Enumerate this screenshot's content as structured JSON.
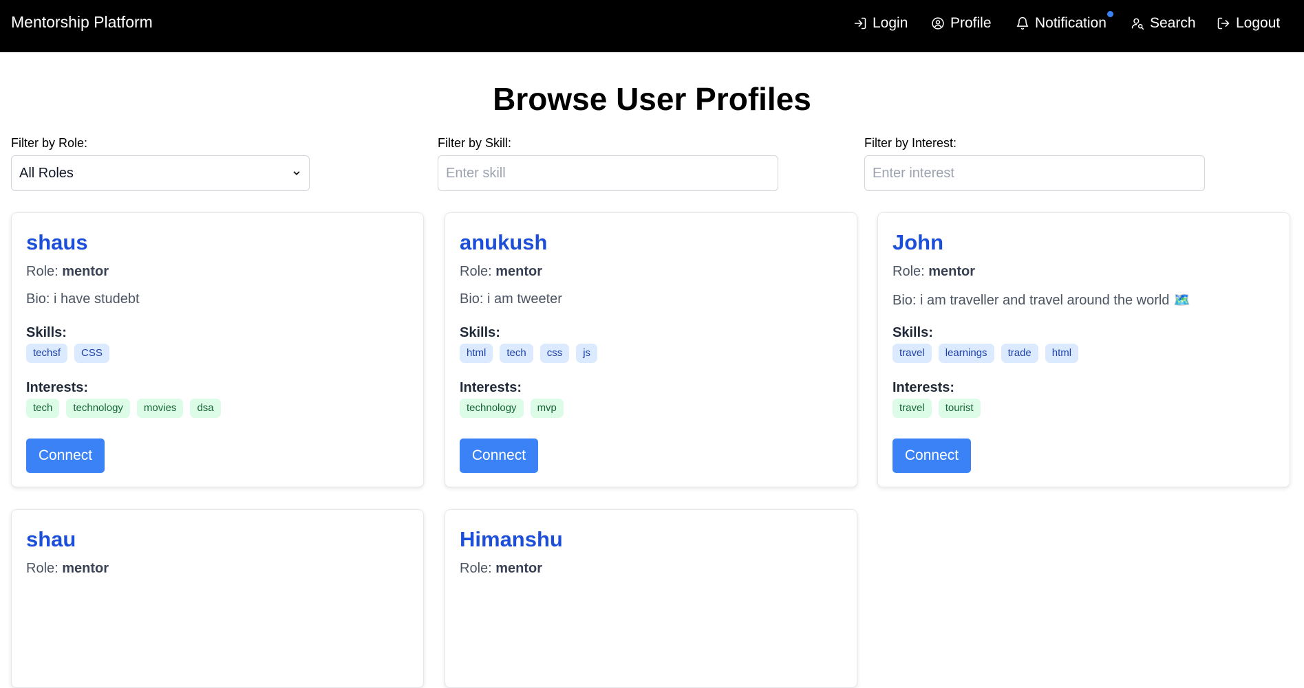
{
  "navbar": {
    "brand": "Mentorship Platform",
    "links": [
      {
        "label": "Login",
        "icon": "login-icon"
      },
      {
        "label": "Profile",
        "icon": "user-circle-icon"
      },
      {
        "label": "Notification",
        "icon": "bell-icon"
      },
      {
        "label": "Search",
        "icon": "user-search-icon"
      },
      {
        "label": "Logout",
        "icon": "logout-icon"
      }
    ],
    "notification_dot_color": "#3b82f6"
  },
  "page": {
    "title": "Browse User Profiles"
  },
  "filters": {
    "role": {
      "label": "Filter by Role:",
      "selected": "All Roles"
    },
    "skill": {
      "label": "Filter by Skill:",
      "placeholder": "Enter skill"
    },
    "interest": {
      "label": "Filter by Interest:",
      "placeholder": "Enter interest"
    }
  },
  "labels": {
    "role_prefix": "Role:",
    "bio_prefix": "Bio:",
    "skills": "Skills:",
    "interests": "Interests:",
    "connect": "Connect"
  },
  "profiles": [
    {
      "name": "shaus",
      "role": "mentor",
      "bio": "i have studebt",
      "skills": [
        "techsf",
        "CSS"
      ],
      "interests": [
        "tech",
        "technology",
        "movies",
        "dsa"
      ]
    },
    {
      "name": "anukush",
      "role": "mentor",
      "bio": "i am tweeter",
      "skills": [
        "html",
        "tech",
        "css",
        "js"
      ],
      "interests": [
        "technology",
        "mvp"
      ]
    },
    {
      "name": "John",
      "role": "mentor",
      "bio": "i am traveller and travel around the world 🗺️",
      "skills": [
        "travel",
        "learnings",
        "trade",
        "html"
      ],
      "interests": [
        "travel",
        "tourist"
      ]
    },
    {
      "name": "shau",
      "role": "mentor"
    },
    {
      "name": "Himanshu",
      "role": "mentor"
    }
  ],
  "colors": {
    "accent": "#3b82f6",
    "name_link": "#1d4ed8",
    "skill_tag_bg": "#dbeafe",
    "interest_tag_bg": "#dcfce7"
  }
}
